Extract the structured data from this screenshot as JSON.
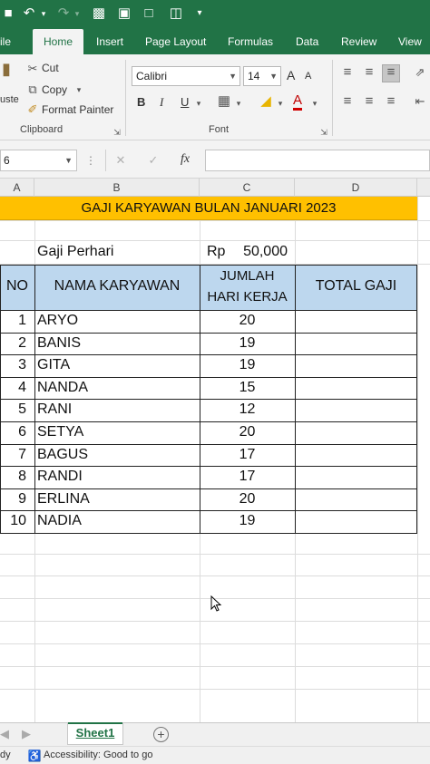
{
  "titlebar": {
    "redo_icon": "redo-icon",
    "customize_icon": "customize-icon"
  },
  "tabs": [
    {
      "label": "ile"
    },
    {
      "label": "Home"
    },
    {
      "label": "Insert"
    },
    {
      "label": "Page Layout"
    },
    {
      "label": "Formulas"
    },
    {
      "label": "Data"
    },
    {
      "label": "Review"
    },
    {
      "label": "View"
    }
  ],
  "ribbon": {
    "paste_partial": "uste",
    "cut_label": "Cut",
    "copy_label": "Copy",
    "format_painter_label": "Format Painter",
    "clipboard_label": "Clipboard",
    "font_name": "Calibri",
    "font_size": "14",
    "font_label": "Font",
    "bold": "B",
    "italic": "I",
    "underline": "U",
    "grow": "A",
    "shrink": "A",
    "font_color_letter": "A"
  },
  "formula_bar": {
    "name_box": "6",
    "fx": "fx"
  },
  "columns": [
    "A",
    "B",
    "C",
    "D"
  ],
  "sheet": {
    "title": "GAJI KARYAWAN BULAN JANUARI 2023",
    "rate_label": "Gaji Perhari",
    "rate_currency": "Rp",
    "rate_value": "50,000",
    "headers": {
      "no": "NO",
      "name": "NAMA KARYAWAN",
      "days_1": "JUMLAH",
      "days_2": "HARI KERJA",
      "total": "TOTAL GAJI"
    },
    "rows": [
      {
        "no": "1",
        "name": "ARYO",
        "days": "20"
      },
      {
        "no": "2",
        "name": "BANIS",
        "days": "19"
      },
      {
        "no": "3",
        "name": "GITA",
        "days": "19"
      },
      {
        "no": "4",
        "name": "NANDA",
        "days": "15"
      },
      {
        "no": "5",
        "name": "RANI",
        "days": "12"
      },
      {
        "no": "6",
        "name": "SETYA",
        "days": "20"
      },
      {
        "no": "7",
        "name": "BAGUS",
        "days": "17"
      },
      {
        "no": "8",
        "name": "RANDI",
        "days": "17"
      },
      {
        "no": "9",
        "name": "ERLINA",
        "days": "20"
      },
      {
        "no": "10",
        "name": "NADIA",
        "days": "19"
      }
    ],
    "accent_title_bg": "#ffc000",
    "accent_header_bg": "#bdd7ee"
  },
  "sheet_tabs": {
    "active": "Sheet1"
  },
  "status": {
    "ready_partial": "dy",
    "accessibility": "Accessibility: Good to go"
  }
}
